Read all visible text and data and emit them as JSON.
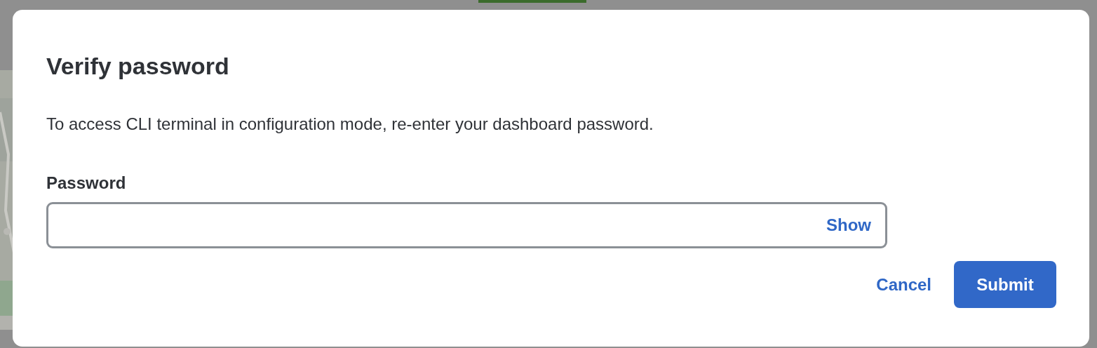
{
  "dialog": {
    "title": "Verify password",
    "description": "To access CLI terminal in configuration mode, re-enter your dashboard password.",
    "password_field": {
      "label": "Password",
      "toggle": "Show"
    },
    "buttons": [
      {
        "kind": "link",
        "label": "Cancel"
      },
      {
        "kind": "primary",
        "label": "Submit"
      }
    ]
  }
}
